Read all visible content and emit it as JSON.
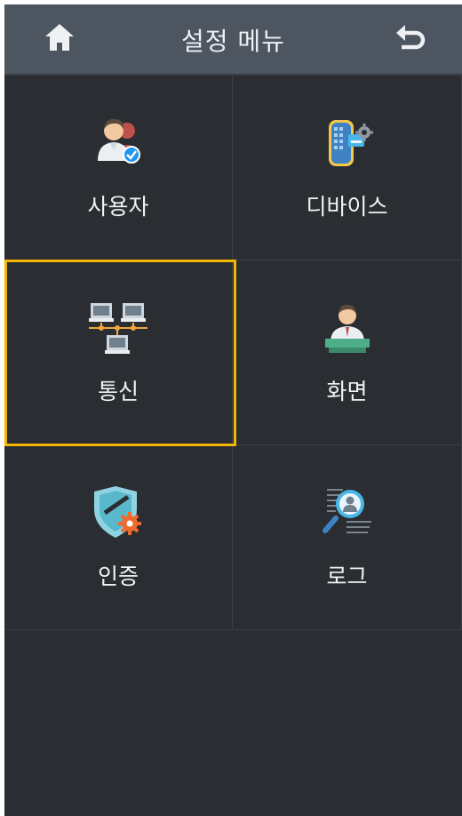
{
  "header": {
    "title": "설정 메뉴",
    "home_icon": "home-icon",
    "back_icon": "back-arrow-icon"
  },
  "menu": {
    "items": [
      {
        "label": "사용자",
        "icon": "user-icon"
      },
      {
        "label": "디바이스",
        "icon": "device-icon"
      },
      {
        "label": "통신",
        "icon": "network-icon",
        "selected": true
      },
      {
        "label": "화면",
        "icon": "display-icon"
      },
      {
        "label": "인증",
        "icon": "shield-icon"
      },
      {
        "label": "로그",
        "icon": "log-search-icon"
      }
    ]
  },
  "colors": {
    "background": "#2a2d31",
    "header": "#4d5561",
    "selection": "#f2b705",
    "text": "#f1f2f4"
  }
}
